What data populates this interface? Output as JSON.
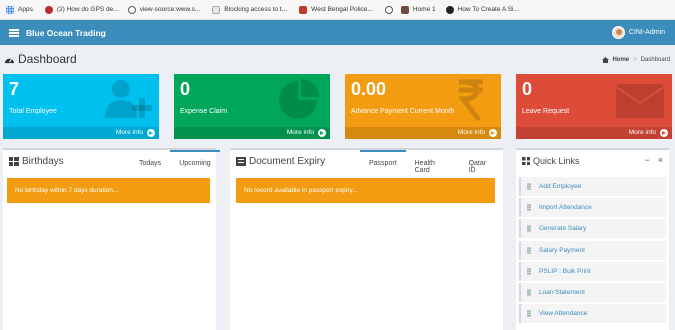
{
  "bookmarks": [
    {
      "label": "Apps",
      "icon": "apps-grid-icon",
      "color": "#4285f4"
    },
    {
      "label": "(2) How do GPS de...",
      "icon": "quora-icon",
      "color": "#b92b27"
    },
    {
      "label": "view-source:www.s...",
      "icon": "globe-icon",
      "color": "#555555"
    },
    {
      "label": "Blocking access to t...",
      "icon": "page-icon",
      "color": "#a0a0a0"
    },
    {
      "label": "West Bengal Police...",
      "icon": "police-badge-icon",
      "color": "#c0392b"
    },
    {
      "label": "",
      "icon": "globe-icon",
      "color": "#555555"
    },
    {
      "label": "Home 1",
      "icon": "home-site-icon",
      "color": "#6d4c41"
    },
    {
      "label": "How To Create A Si...",
      "icon": "circle-site-icon",
      "color": "#222222"
    }
  ],
  "header": {
    "brand": "Blue Ocean Trading",
    "user": "CINI-Admin",
    "color": "#3c8dbc"
  },
  "page": {
    "title": "Dashboard",
    "breadcrumb_home": "Home",
    "breadcrumb_current": "Dashboard"
  },
  "stat_boxes": [
    {
      "value": "7",
      "label": "Total Employee",
      "footer": "More info",
      "color": "#00c0ef",
      "icon": "user-plus-icon"
    },
    {
      "value": "0",
      "label": "Expense Claim",
      "footer": "More info",
      "color": "#00a65a",
      "icon": "pie-chart-icon"
    },
    {
      "value": "0.00",
      "label": "Advance Payment Current Month",
      "footer": "More info",
      "color": "#f39c12",
      "icon": "rupee-icon"
    },
    {
      "value": "0",
      "label": "Leave Request",
      "footer": "More info",
      "color": "#dd4b39",
      "icon": "envelope-icon"
    }
  ],
  "birthdays": {
    "title": "Birthdays",
    "tabs": [
      "Todays",
      "Upcoming"
    ],
    "active_tab": "Upcoming",
    "message": "No birthday within 7 days duration..."
  },
  "documents": {
    "title": "Document Expiry",
    "tabs": [
      "Passport",
      "Health Card",
      "Qatar ID"
    ],
    "active_tab": "Passport",
    "message": "No record available in passport expiry..."
  },
  "quick_links": {
    "title": "Quick Links",
    "minimize": "−",
    "close": "×",
    "items": [
      "Add Employee",
      "Import Attendance",
      "Generate Salary",
      "Salary Payment",
      "PSLIP : Bulk Print",
      "Loan Statement",
      "View Attendance"
    ]
  }
}
